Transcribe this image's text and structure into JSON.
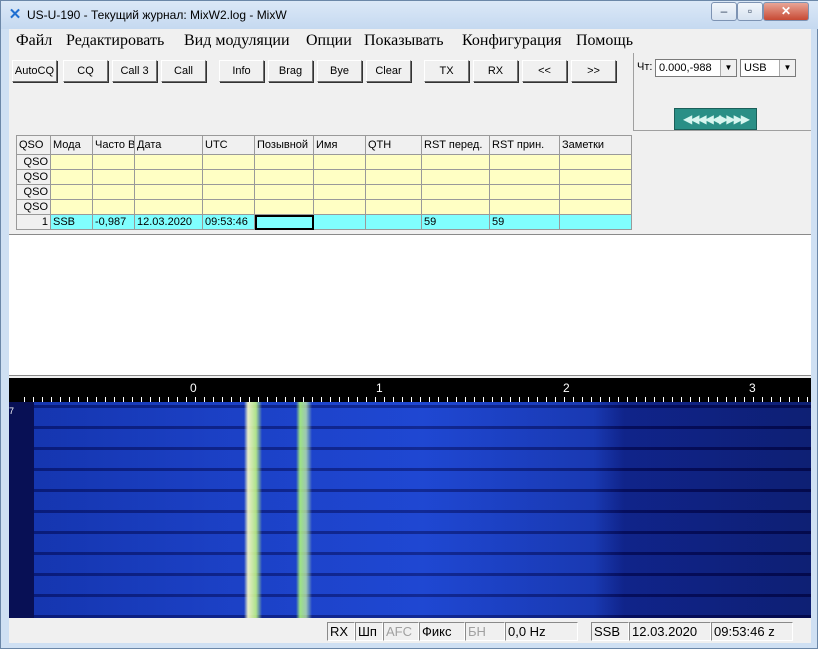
{
  "window": {
    "title": "US-U-190 - Текущий журнал: MixW2.log - MixW",
    "icon": "mixw-logo"
  },
  "menu": [
    "Файл",
    "Редактировать",
    "Вид модуляции",
    "Опции",
    "Показывать",
    "Конфигурация",
    "Помощь"
  ],
  "toolbar": {
    "buttons": [
      "AutoCQ",
      "CQ",
      "Call 3",
      "Call",
      "Info",
      "Brag",
      "Bye",
      "Clear",
      "TX",
      "RX",
      "<<",
      ">>"
    ],
    "cat_label": "Чт:",
    "cat_value": "0.000,-988",
    "mode_value": "USB",
    "tune_arrows": "◀◀◀◀◀▶▶▶▶"
  },
  "log_grid": {
    "headers": [
      "QSO",
      "Мода",
      "Часто ВЧ",
      "Дата",
      "UTC",
      "Позывной",
      "Имя",
      "QTH",
      "RST перед.",
      "RST прин.",
      "Заметки"
    ],
    "empty_rows": [
      "QSO",
      "QSO",
      "QSO",
      "QSO"
    ],
    "current_row": [
      "1",
      "SSB",
      "-0,987",
      "12.03.2020",
      "09:53:46",
      "",
      "",
      "",
      "59",
      "59",
      ""
    ]
  },
  "actions": {
    "icons": [
      "glasses-icon",
      "edit-icon",
      "delete-icon",
      "save-icon"
    ],
    "find_icon": "magnifier-icon"
  },
  "scale": {
    "labels": [
      "0",
      "1",
      "2",
      "3"
    ],
    "left_mark": "7"
  },
  "status": [
    "RX",
    "Шп",
    "AFC",
    "Фикс",
    "БН",
    "0,0 Hz",
    "SSB",
    "12.03.2020",
    "09:53:46 z"
  ]
}
